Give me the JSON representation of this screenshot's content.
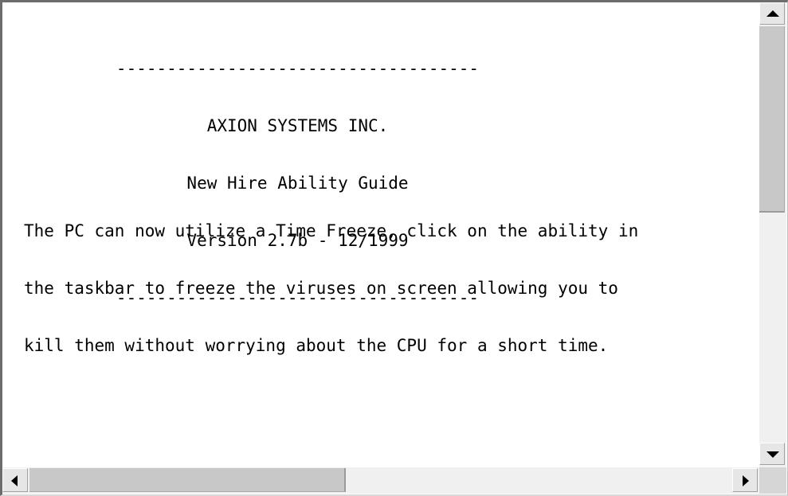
{
  "document": {
    "header_lines": [
      "------------------------------------",
      "AXION SYSTEMS INC.",
      "New Hire Ability Guide",
      "Version 2.7b - 12/1999",
      "------------------------------------"
    ],
    "body_lines": [
      "The PC can now utilize a Time Freeze, click on the ability in",
      "the taskbar to freeze the viruses on screen allowing you to",
      "kill them without worrying about the CPU for a short time."
    ]
  },
  "scrollbars": {
    "vertical_position": 0.0,
    "vertical_visible_fraction": 0.47,
    "horizontal_position": 0.0,
    "horizontal_visible_fraction": 0.45,
    "up_icon": "arrow-up-icon",
    "down_icon": "arrow-down-icon",
    "left_icon": "arrow-left-icon",
    "right_icon": "arrow-right-icon"
  }
}
